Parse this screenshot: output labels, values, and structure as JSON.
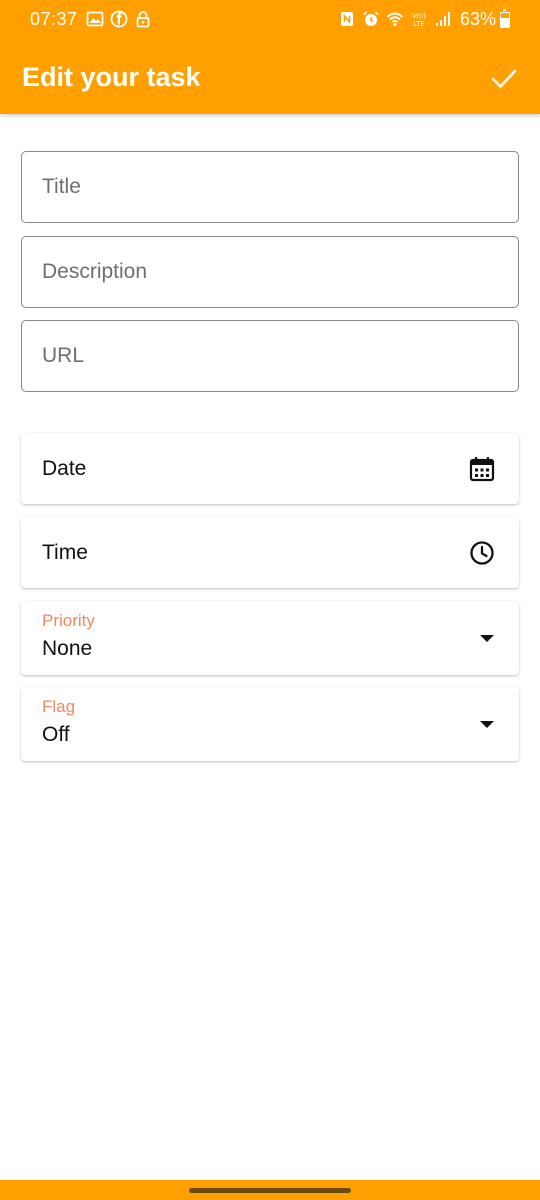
{
  "status_bar": {
    "time": "07:37",
    "battery": "63%",
    "left_icons": [
      "gallery-icon",
      "facebook-icon",
      "lock-icon"
    ],
    "right_icons": [
      "nfc-icon",
      "alarm-icon",
      "wifi-icon",
      "volte-icon",
      "signal-icon",
      "battery-icon"
    ]
  },
  "toolbar": {
    "title": "Edit your task",
    "confirm_icon": "check-icon"
  },
  "form": {
    "title_placeholder": "Title",
    "title_value": "",
    "description_placeholder": "Description",
    "description_value": "",
    "url_placeholder": "URL",
    "url_value": ""
  },
  "pickers": {
    "date_label": "Date",
    "date_icon": "calendar-icon",
    "time_label": "Time",
    "time_icon": "clock-icon"
  },
  "dropdowns": {
    "priority_caption": "Priority",
    "priority_value": "None",
    "flag_caption": "Flag",
    "flag_value": "Off"
  },
  "colors": {
    "accent": "#FFA000",
    "caption": "#F2875E"
  }
}
